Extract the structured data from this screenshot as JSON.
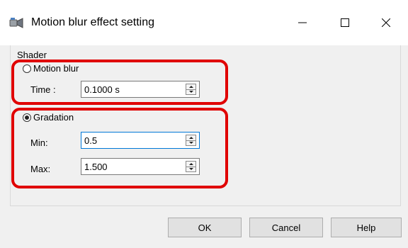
{
  "window": {
    "title": "Motion blur effect setting",
    "icon": "motion-blur-app-icon"
  },
  "shader": {
    "group_label": "Shader",
    "motion_blur": {
      "label": "Motion blur",
      "selected": false,
      "time_label": "Time :",
      "time_value": "0.1000 s"
    },
    "gradation": {
      "label": "Gradation",
      "selected": true,
      "min_label": "Min:",
      "min_value": "0.5",
      "max_label": "Max:",
      "max_value": "1.500"
    }
  },
  "buttons": {
    "ok": "OK",
    "cancel": "Cancel",
    "help": "Help"
  },
  "colors": {
    "highlight": "#e00000",
    "focus": "#0078d7"
  }
}
